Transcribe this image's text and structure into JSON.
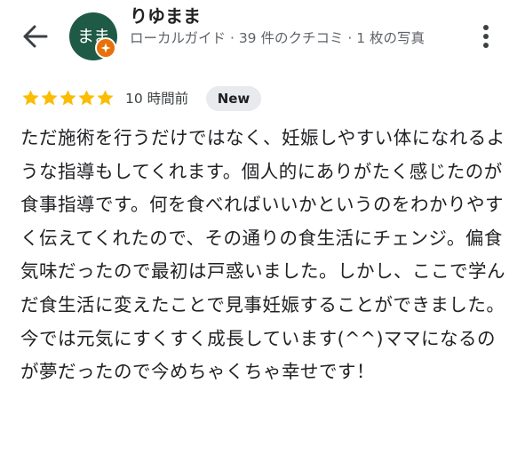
{
  "header": {
    "back_icon": "arrow-back-icon",
    "more_icon": "more-vert-icon"
  },
  "reviewer": {
    "avatar_text": "まま",
    "avatar_color": "#1e5a45",
    "badge_icon": "local-guide-icon",
    "badge_color": "#e8710a",
    "name": "りゆまま",
    "meta": "ローカルガイド · 39 件のクチコミ · 1 枚の写真"
  },
  "rating": {
    "stars": 5,
    "max_stars": 5,
    "star_color": "#fbbc04",
    "time_ago": "10 時間前",
    "new_label": "New"
  },
  "review": {
    "text": "ただ施術を行うだけではなく、妊娠しやすい体になれるような指導もしてくれます。個人的にありがたく感じたのが食事指導です。何を食べればいいかというのをわかりやすく伝えてくれたので、その通りの食生活にチェンジ。偏食気味だったので最初は戸惑いました。しかし、ここで学んだ食生活に変えたことで見事妊娠することができました。今では元気にすくすく成長しています(^^)ママになるのが夢だったので今めちゃくちゃ幸せです！"
  }
}
